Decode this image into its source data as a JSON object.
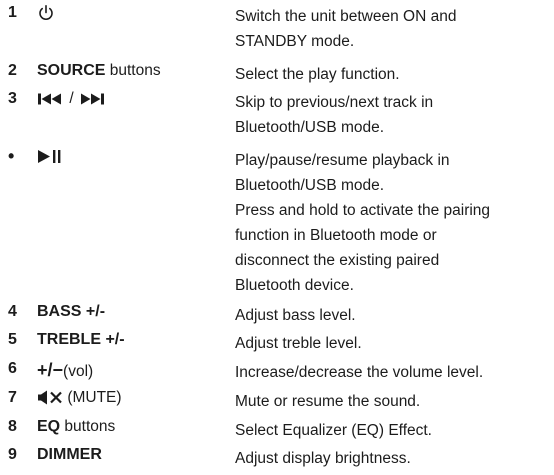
{
  "items": [
    {
      "num": "1",
      "term_plain": "",
      "term_bold": "",
      "icon": "power-icon",
      "desc": [
        "Switch the unit between ON and",
        "STANDBY mode."
      ]
    },
    {
      "num": "2",
      "term_bold": "SOURCE",
      "term_plain": " buttons",
      "icon": "",
      "desc": [
        "Select the play function."
      ]
    },
    {
      "num": "3",
      "term_bold": "",
      "term_plain": "",
      "icon": "skip-previous-next-icon",
      "separator": " / ",
      "desc": [
        "Skip to previous/next track in",
        "Bluetooth/USB mode."
      ]
    },
    {
      "num": "•",
      "term_bold": "",
      "term_plain": "",
      "icon": "play-pause-icon",
      "desc": [
        "Play/pause/resume playback in",
        "Bluetooth/USB mode.",
        "Press and hold to activate the pairing",
        "function in Bluetooth mode or",
        "disconnect the existing paired",
        "Bluetooth device."
      ]
    },
    {
      "num": "4",
      "term_bold": "BASS +/-",
      "term_plain": "",
      "icon": "",
      "desc": [
        "Adjust bass level."
      ]
    },
    {
      "num": "5",
      "term_bold": "TREBLE +/-",
      "term_plain": "",
      "icon": "",
      "desc": [
        "Adjust treble level."
      ]
    },
    {
      "num": "6",
      "term_bold": "+/−",
      "term_plain": "(vol)",
      "icon": "",
      "desc": [
        "Increase/decrease the volume level."
      ]
    },
    {
      "num": "7",
      "term_bold": "",
      "term_plain": " (MUTE)",
      "icon": "mute-icon",
      "desc": [
        "Mute or resume the sound."
      ]
    },
    {
      "num": "8",
      "term_bold": "EQ",
      "term_plain": " buttons",
      "icon": "",
      "desc": [
        "Select Equalizer (EQ) Effect."
      ]
    },
    {
      "num": "9",
      "term_bold": "DIMMER",
      "term_plain": "",
      "icon": "",
      "desc": [
        "Adjust display brightness."
      ]
    }
  ]
}
